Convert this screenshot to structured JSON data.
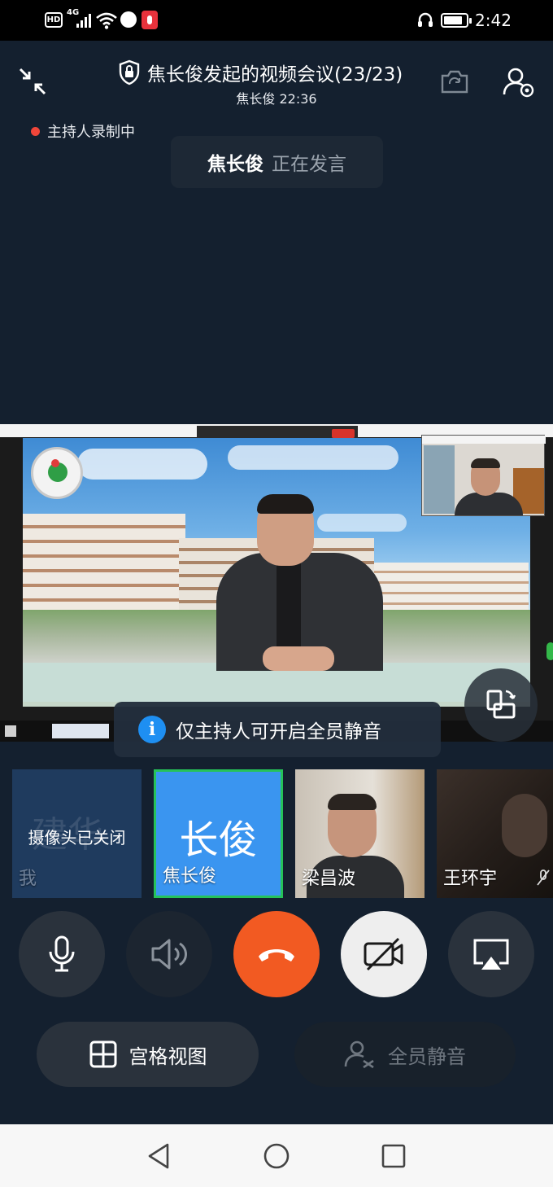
{
  "status_bar": {
    "hd_label": "HD",
    "network_label": "4G",
    "time": "2:42"
  },
  "header": {
    "title": "焦长俊发起的视频会议(23/23)",
    "subtitle": "焦长俊 22:36",
    "recording_label": "主持人录制中",
    "speaker_name": "焦长俊",
    "speaker_status": "正在发言"
  },
  "toast": {
    "icon": "i",
    "text": "仅主持人可开启全员静音"
  },
  "participants": [
    {
      "bg_name": "建华",
      "status": "摄像头已关闭",
      "name": "我",
      "color": "#1e3a5c"
    },
    {
      "avatar_text": "长俊",
      "name": "焦长俊",
      "color": "#3a95f0",
      "border": "#26c25a"
    },
    {
      "name": "梁昌波"
    },
    {
      "name": "王环宇"
    }
  ],
  "controls": {
    "mic": "microphone-icon",
    "speaker": "speaker-icon",
    "hangup": "hang-up-icon",
    "camera": "camera-off-icon",
    "share": "screen-share-icon",
    "hangup_color": "#f25a22"
  },
  "bottom_buttons": {
    "grid_label": "宫格视图",
    "mute_all_label": "全员静音"
  },
  "colors": {
    "background": "#14202f",
    "recording_dot": "#f0463a",
    "info_blue": "#1e8ff2"
  }
}
